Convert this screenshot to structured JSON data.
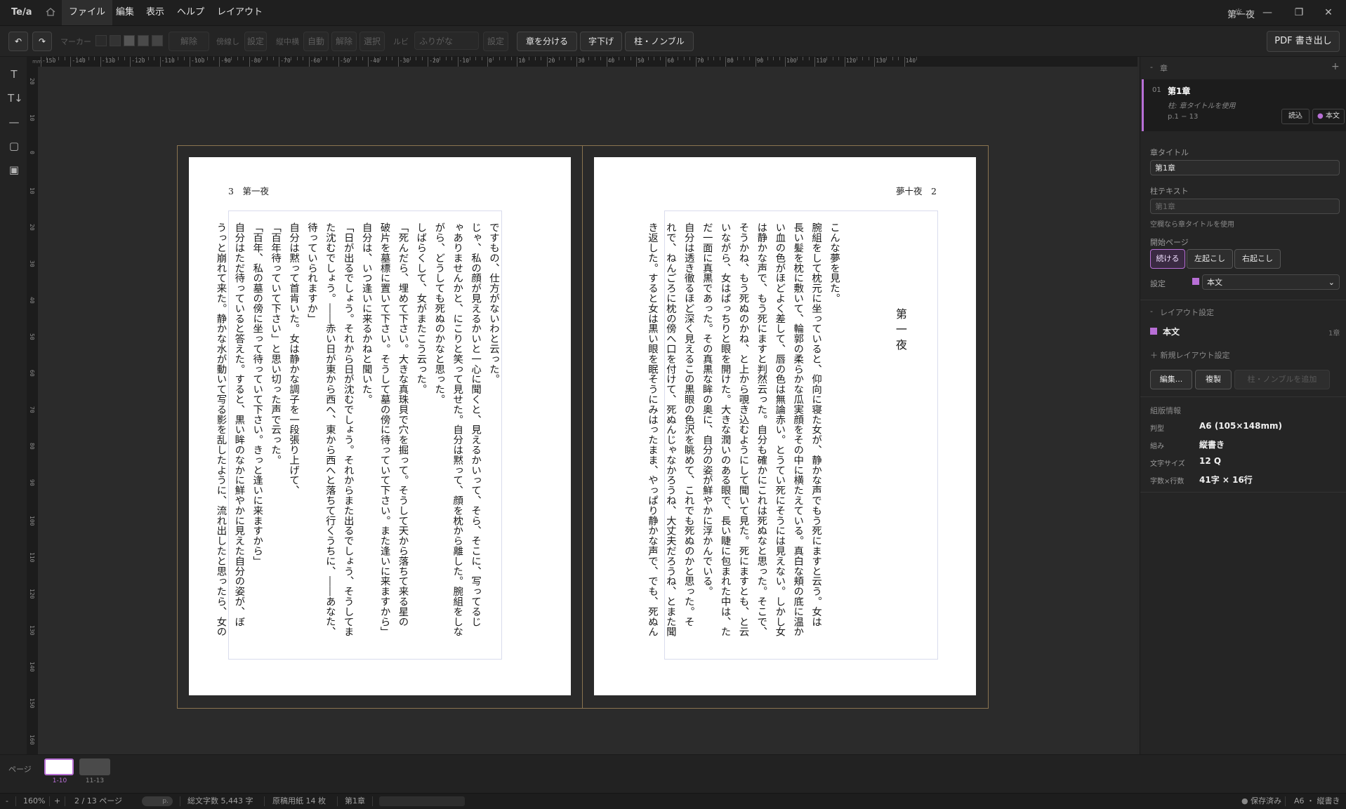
{
  "app": {
    "logo": "Te/a",
    "document_title": "第一夜"
  },
  "menu": [
    "ファイル",
    "編集",
    "表示",
    "ヘルプ",
    "レイアウト"
  ],
  "toolbar": {
    "marker_label": "マーカー",
    "clear_label": "解除",
    "tatebo_label": "傍線し",
    "tatebo_btn": "設定",
    "tcy_label": "縦中横",
    "tcy_btns": [
      "自動",
      "解除",
      "選択"
    ],
    "ruby_label": "ルビ",
    "ruby_field": "ふりがな",
    "ruby_btn": "設定",
    "split_chapter": "章を分ける",
    "indent": "字下げ",
    "header_nombre": "柱・ノンブル",
    "pdf_export": "PDF 書き出し"
  },
  "ruler": {
    "h_labels": [
      "-150",
      "-140",
      "-130",
      "-120",
      "-110",
      "-100",
      "-90",
      "-80",
      "-70",
      "-60",
      "-50",
      "-40",
      "-30",
      "-20",
      "-10",
      "0",
      "10",
      "20",
      "30",
      "40",
      "50",
      "60",
      "70",
      "80",
      "90",
      "100",
      "110",
      "120",
      "130",
      "140"
    ],
    "v_labels": [
      "20",
      "10",
      "0",
      "10",
      "20",
      "30",
      "40",
      "50",
      "60",
      "70",
      "80",
      "90",
      "100",
      "110",
      "120",
      "130",
      "140",
      "150",
      "160"
    ]
  },
  "left_page": {
    "running_head": "3　第一夜",
    "lines": [
      "ですもの、仕方がないわと云った。",
      "じゃ、私の顔が見えるかいと一心に聞くと、見えるかいって、そら、そこに、写ってるじ",
      "ゃありませんかと、にこりと笑って見せた。自分は黙って、顔を枕から離した。腕組をしな",
      "がら、どうしても死ぬのかなと思った。",
      "しばらくして、女がまたこう云った。",
      "「死んだら、埋めて下さい。大きな真珠貝で穴を掘って。そうして天から落ちて来る星の",
      "破片を墓標に置いて下さい。そうして墓の傍に待っていて下さい。また逢いに来ますから」",
      "自分は、いつ逢いに来るかねと聞いた。",
      "「日が出るでしょう。それから日が沈むでしょう。それからまた出るでしょう、そうしてま",
      "た沈むでしょう。――赤い日が東から西へ、東から西へと落ちて行くうちに、――あなた、",
      "待っていられますか」",
      "自分は黙って首肯いた。女は静かな調子を一段張り上げて、",
      "「百年待っていて下さい」と思い切った声で云った。",
      "「百年、私の墓の傍に坐って待っていて下さい。きっと逢いに来ますから」",
      "自分はただ待っていると答えた。すると、黒い眸のなかに鮮やかに見えた自分の姿が、ぼ",
      "うっと崩れて来た。静かな水が動いて写る影を乱したように、流れ出したと思ったら、女の"
    ]
  },
  "right_page": {
    "running_head": "夢十夜　2",
    "title": "第一夜",
    "lines": [
      "こんな夢を見た。",
      "腕組をして枕元に坐っていると、仰向に寝た女が、静かな声でもう死にますと云う。女は",
      "長い髪を枕に敷いて、輪郭の柔らかな瓜実顔をその中に横たえている。真白な頬の底に温か",
      "い血の色がほどよく差して、唇の色は無論赤い。とうてい死にそうには見えない。しかし女",
      "は静かな声で、もう死にますと判然云った。自分も確かにこれは死ぬなと思った。そこで、",
      "そうかね、もう死ぬのかね、と上から覗き込むようにして聞いて見た。死にますとも、と云",
      "いながら、女はぱっちりと眼を開けた。大きな潤いのある眼で、長い睫に包まれた中は、た",
      "だ一面に真黒であった。その真黒な眸の奥に、自分の姿が鮮やかに浮かんでいる。",
      "自分は透き徹るほど深く見えるこの黒眼の色沢を眺めて、これでも死ぬのかと思った。そ",
      "れで、ねんごろに枕の傍へ口を付けて、死ぬんじゃなかろうね、大丈夫だろうね、とまた聞",
      "き返した。すると女は黒い眼を眠そうにみはったまま、やっぱり静かな声で、でも、死ぬん"
    ]
  },
  "panel": {
    "chapters_header": "章",
    "chapter": {
      "num": "01",
      "name": "第1章",
      "sub": "柱: 章タイトルを使用",
      "pages": "p.1 − 13",
      "import_btn": "読込",
      "layout_tag": "本文"
    },
    "chapter_title_label": "章タイトル",
    "chapter_title_value": "第1章",
    "header_text_label": "柱テキスト",
    "header_text_placeholder": "第1章",
    "header_hint": "空欄なら章タイトルを使用",
    "start_page_label": "開始ページ",
    "start_options": [
      "続ける",
      "左起こし",
      "右起こし"
    ],
    "setting_label": "設定",
    "setting_value": "本文",
    "layout_settings_header": "レイアウト設定",
    "layout_item": {
      "name": "本文",
      "count": "1章"
    },
    "new_layout": "＋ 新規レイアウト設定",
    "buttons": [
      "編集...",
      "複製",
      "柱・ノンブルを追加"
    ],
    "info_header": "組版情報",
    "info": [
      {
        "label": "判型",
        "value": "A6 (105×148mm)"
      },
      {
        "label": "組み",
        "value": "縦書き"
      },
      {
        "label": "文字サイズ",
        "value": "12 Q"
      },
      {
        "label": "字数×行数",
        "value": "41字 × 16行"
      }
    ],
    "accent": "#b86fd6"
  },
  "pagestrip": {
    "label": "ページ",
    "thumbs": [
      "1-10",
      "11-13"
    ]
  },
  "status": {
    "zoom_minus": "-",
    "zoom": "160%",
    "zoom_plus": "+",
    "page": "2 / 13 ページ",
    "goto_placeholder": "p.",
    "char_count": "総文字数 5,443 字",
    "manuscript": "原稿用紙 14 枚",
    "chapter": "第1章",
    "saved": "保存済み",
    "format": "A6 ・ 縦書き"
  }
}
